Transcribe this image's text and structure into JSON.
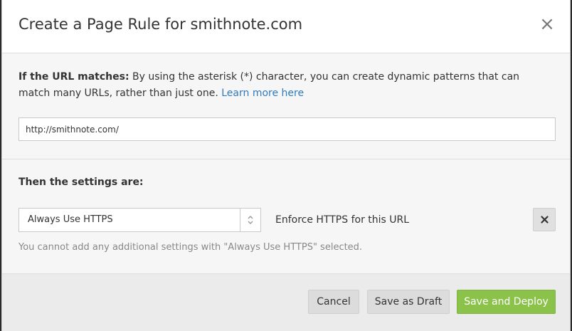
{
  "dialog": {
    "title": "Create a Page Rule for smithnote.com",
    "close_icon": "×"
  },
  "url_section": {
    "heading": "If the URL matches:",
    "description": " By using the asterisk (*) character, you can create dynamic patterns that can match many URLs, rather than just one. ",
    "learn_more": "Learn more here",
    "url_value": "http://smithnote.com/"
  },
  "settings_section": {
    "heading": "Then the settings are:",
    "selected_setting": "Always Use HTTPS",
    "setting_description": "Enforce HTTPS for this URL",
    "note": "You cannot add any additional settings with \"Always Use HTTPS\" selected."
  },
  "footer": {
    "cancel_label": "Cancel",
    "draft_label": "Save as Draft",
    "deploy_label": "Save and Deploy"
  },
  "colors": {
    "link": "#2f7bbf",
    "primary": "#8bc34a"
  }
}
